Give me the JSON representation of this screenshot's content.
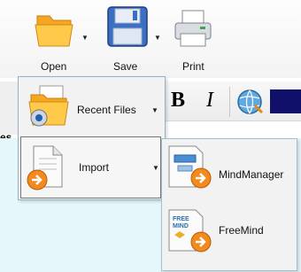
{
  "toolbar": {
    "open_label": "Open",
    "save_label": "Save",
    "print_label": "Print",
    "bold_label": "B",
    "italic_label": "I",
    "font_color_hex": "#10106a"
  },
  "background_fragment": "es",
  "menu": {
    "items": [
      {
        "label": "Recent Files",
        "icon": "recent-files-folder-icon",
        "has_submenu": true
      },
      {
        "label": "Import",
        "icon": "import-document-icon",
        "has_submenu": true
      }
    ]
  },
  "import_submenu": {
    "items": [
      {
        "label": "MindManager",
        "icon": "mindmanager-icon"
      },
      {
        "label": "FreeMind",
        "icon": "freemind-icon",
        "icon_text": "FREE MIND"
      }
    ]
  },
  "colors": {
    "menu_border": "#8fb3c7",
    "menu_background": "#f2f2f2",
    "canvas_background": "#e6f7fb",
    "accent_orange": "#f28a1e"
  }
}
